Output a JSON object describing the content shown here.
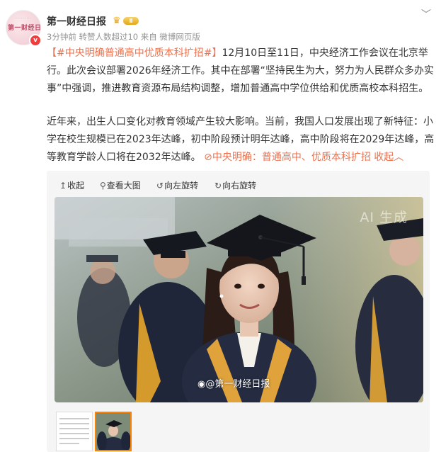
{
  "header": {
    "account_name": "第一财经日报",
    "avatar_text": "第一财经日报",
    "vip_level": "Ⅱ",
    "meta": "3分钟前 转赞人数超过10  来自 微博网页版"
  },
  "post": {
    "tag": "【#中央明确普通高中优质本科扩招#】",
    "para1": "12月10日至11日，中央经济工作会议在北京举行。此次会议部署2026年经济工作。其中在部署“坚持民生为大，努力为人民群众多办实事”中强调，推进教育资源布局结构调整，增加普通高中学位供给和优质高校本科招生。",
    "para2": "近年来，出生人口变化对教育领域产生较大影响。当前，我国人口发展出现了新特征：小学在校生规模已在2023年达峰，初中阶段预计明年达峰，高中阶段将在2029年达峰，高等教育学龄人口将在2032年达峰。",
    "link": "中央明确：普通高中、优质本科扩招",
    "fold": "收起"
  },
  "media": {
    "toolbar": {
      "collapse": "收起",
      "view_large": "查看大图",
      "rotate_left": "向左旋转",
      "rotate_right": "向右旋转"
    },
    "ai_label": "AI 生成",
    "watermark": "@第一财经日报"
  }
}
